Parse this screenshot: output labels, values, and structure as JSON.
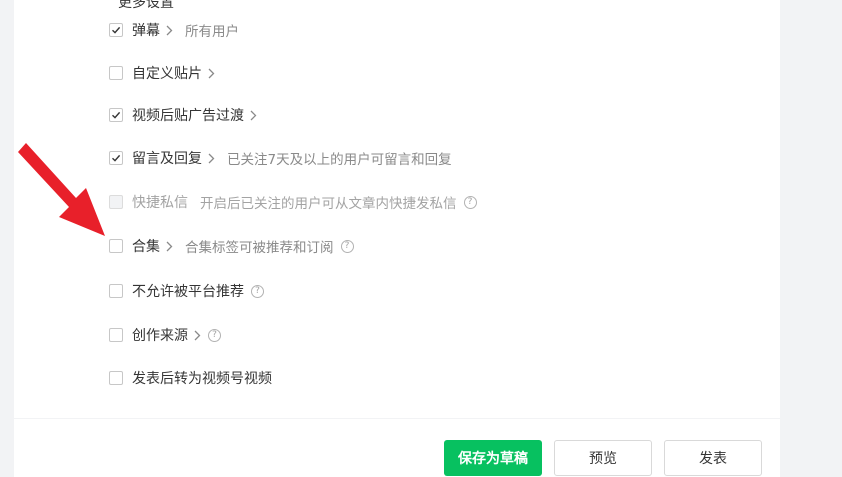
{
  "section": {
    "title": "更多设置"
  },
  "options": [
    {
      "label": "弹幕",
      "checked": true,
      "has_chevron": true,
      "description": "所有用户",
      "help": false,
      "disabled": false
    },
    {
      "label": "自定义贴片",
      "checked": false,
      "has_chevron": true,
      "description": "",
      "help": false,
      "disabled": false
    },
    {
      "label": "视频后贴广告过渡",
      "checked": true,
      "has_chevron": true,
      "description": "",
      "help": false,
      "disabled": false
    },
    {
      "label": "留言及回复",
      "checked": true,
      "has_chevron": true,
      "description": "已关注7天及以上的用户可留言和回复",
      "help": false,
      "disabled": false
    },
    {
      "label": "快捷私信",
      "checked": false,
      "has_chevron": false,
      "description": "开启后已关注的用户可从文章内快捷发私信",
      "help": true,
      "disabled": true
    },
    {
      "label": "合集",
      "checked": false,
      "has_chevron": true,
      "description": "合集标签可被推荐和订阅",
      "help": true,
      "disabled": false
    },
    {
      "label": "不允许被平台推荐",
      "checked": false,
      "has_chevron": false,
      "description": "",
      "help": true,
      "disabled": false
    },
    {
      "label": "创作来源",
      "checked": false,
      "has_chevron": true,
      "description": "",
      "help": true,
      "disabled": false
    },
    {
      "label": "发表后转为视频号视频",
      "checked": false,
      "has_chevron": false,
      "description": "",
      "help": false,
      "disabled": false
    }
  ],
  "help_glyph": "?",
  "footer": {
    "save_draft": "保存为草稿",
    "preview": "预览",
    "publish": "发表"
  },
  "colors": {
    "primary": "#07c160",
    "annotation_arrow": "#e8202a"
  },
  "icons": {
    "check": "check-icon",
    "chevron": "chevron-right-icon",
    "help": "help-circle-icon",
    "annotation": "red-arrow-annotation"
  }
}
